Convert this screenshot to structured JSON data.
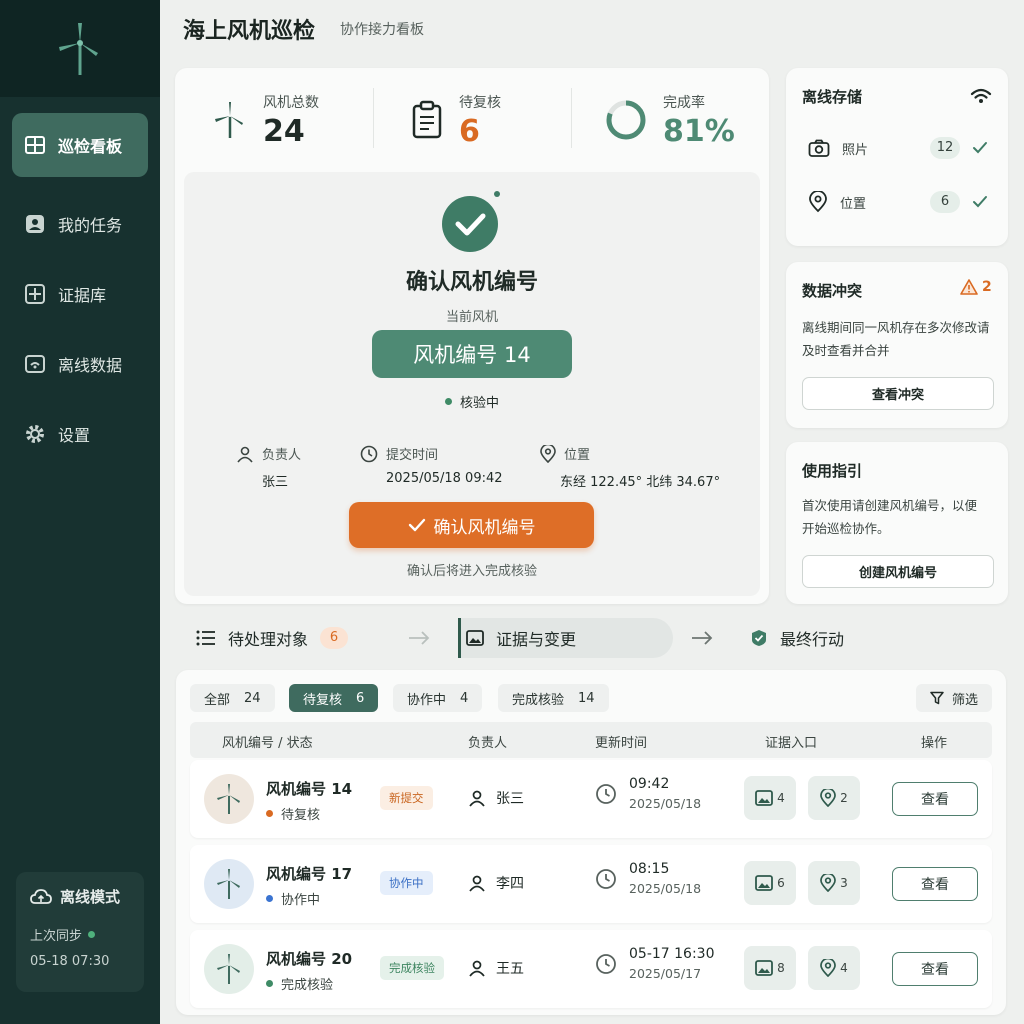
{
  "app": {
    "title": "海上风机巡检",
    "subtitle": "协作接力看板"
  },
  "sidebar": {
    "items": [
      {
        "label": "巡检看板",
        "icon": "dashboard-icon",
        "active": true
      },
      {
        "label": "我的任务",
        "icon": "task-icon"
      },
      {
        "label": "证据库",
        "icon": "evidence-icon"
      },
      {
        "label": "离线数据",
        "icon": "offline-data-icon"
      },
      {
        "label": "设置",
        "icon": "gear-icon"
      }
    ],
    "offline": {
      "title": "离线模式",
      "last_sync_label": "上次同步",
      "last_sync_value": "05-18 07:30"
    }
  },
  "stats": {
    "total": {
      "label": "风机总数",
      "value": "24"
    },
    "pending": {
      "label": "待复核",
      "value": "6"
    },
    "completion": {
      "label": "完成率",
      "value": "81%",
      "ratio": 0.81
    }
  },
  "confirm": {
    "title": "确认风机编号",
    "current_label": "当前风机",
    "turbine": "风机编号 14",
    "status": "核验中",
    "owner_label": "负责人",
    "owner": "张三",
    "submit_label": "提交时间",
    "submit_time": "2025/05/18 09:42",
    "location_label": "位置",
    "location": "东经 122.45° 北纬 34.67°",
    "button": "确认风机编号",
    "hint": "确认后将进入完成核验"
  },
  "offline_storage": {
    "title": "离线存储",
    "rows": [
      {
        "label": "照片",
        "count": "12"
      },
      {
        "label": "位置",
        "count": "6"
      }
    ]
  },
  "conflict": {
    "title": "数据冲突",
    "count": "2",
    "text": "离线期间同一风机存在多次修改请及时查看并合并",
    "button": "查看冲突"
  },
  "guide": {
    "title": "使用指引",
    "text": "首次使用请创建风机编号，以便开始巡检协作。",
    "button": "创建风机编号"
  },
  "steps": [
    {
      "label": "待处理对象",
      "count": "6"
    },
    {
      "label": "证据与变更"
    },
    {
      "label": "最终行动"
    }
  ],
  "filters": [
    {
      "label": "全部",
      "count": "24"
    },
    {
      "label": "待复核",
      "count": "6",
      "active": true
    },
    {
      "label": "协作中",
      "count": "4"
    },
    {
      "label": "完成核验",
      "count": "14"
    }
  ],
  "filter_button": "筛选",
  "table": {
    "headers": {
      "id": "风机编号 / 状态",
      "owner": "负责人",
      "time": "更新时间",
      "evidence": "证据入口",
      "action": "操作"
    },
    "rows": [
      {
        "name": "风机编号 14",
        "status": "待复核",
        "status_color": "#d96a22",
        "tag": "新提交",
        "tag_bg": "#fbeee3",
        "tag_fg": "#c9651f",
        "avatar_bg": "#efe7de",
        "owner": "张三",
        "time": "09:42",
        "date": "2025/05/18",
        "photos": "4",
        "locations": "2",
        "action": "查看"
      },
      {
        "name": "风机编号 17",
        "status": "协作中",
        "status_color": "#3b74d1",
        "tag": "协作中",
        "tag_bg": "#e5eefb",
        "tag_fg": "#3a6fc4",
        "avatar_bg": "#dfe9f4",
        "owner": "李四",
        "time": "08:15",
        "date": "2025/05/18",
        "photos": "6",
        "locations": "3",
        "action": "查看"
      },
      {
        "name": "风机编号 20",
        "status": "完成核验",
        "status_color": "#3f8b66",
        "tag": "完成核验",
        "tag_bg": "#e5f1ea",
        "tag_fg": "#3d8560",
        "avatar_bg": "#e3eee8",
        "owner": "王五",
        "time": "05-17 16:30",
        "date": "2025/05/17",
        "photos": "8",
        "locations": "4",
        "action": "查看"
      }
    ]
  },
  "colors": {
    "accent": "#3f6b5f",
    "orange": "#de6e27",
    "sidebar": "#17312f"
  }
}
